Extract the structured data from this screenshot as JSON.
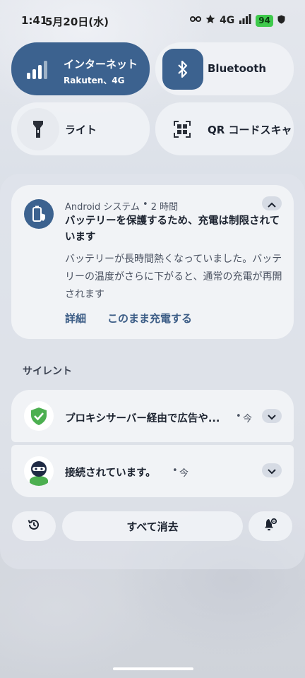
{
  "status_bar": {
    "time": "1:41",
    "date": "5月20日(水)",
    "network": "4G",
    "battery": "94"
  },
  "tiles": {
    "internet": {
      "label": "インターネット",
      "sublabel": "Rakuten、4G"
    },
    "bluetooth": {
      "label": "Bluetooth"
    },
    "flashlight": {
      "label": "ライト"
    },
    "qr": {
      "label": "QR コードスキャ"
    }
  },
  "notification": {
    "app": "Android システム",
    "time": "2 時間",
    "title": "バッテリーを保護するため、充電は制限されています",
    "body": "バッテリーが長時間熱くなっていました。バッテリーの温度がさらに下がると、通常の充電が再開されます",
    "action_details": "詳細",
    "action_charge": "このまま充電する"
  },
  "silent_section": {
    "header": "サイレント",
    "items": [
      {
        "text": "プロキシサーバー経由で広告や...",
        "time": "今"
      },
      {
        "text": "接続されています。",
        "time": "今"
      }
    ]
  },
  "footer": {
    "clear_all": "すべて消去"
  },
  "colors": {
    "accent": "#3c628f",
    "battery_green": "#3fca4c"
  }
}
